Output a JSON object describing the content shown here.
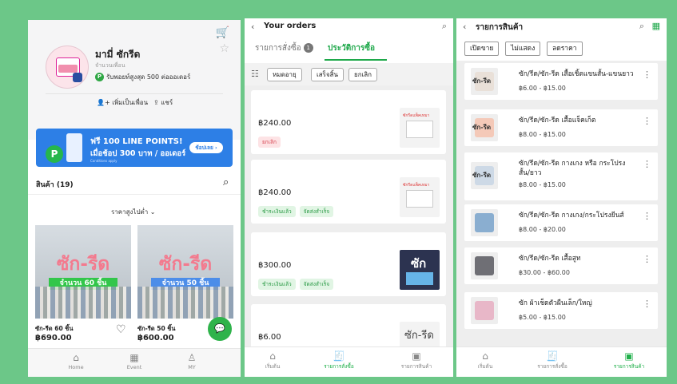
{
  "shop": {
    "name": "มามี่ ซักรีด",
    "subtitle": "จำนวนเพื่อน",
    "badge_letter": "P",
    "min_order": "รับพอยท์สูงสุด 500 ต่อออเดอร์",
    "add_friend": "เพิ่มเป็นเพื่อน",
    "share": "แชร์",
    "banner": {
      "line1": "ฟรี 100 LINE POINTS!",
      "line2": "เมื่อช้อป 300 บาท / ออเดอร์",
      "fine_print": "Conditions apply",
      "button": "ช้อปเลย ›"
    },
    "products_title": "สินค้า (19)",
    "sort_label": "ราคาสูงไปต่ำ ⌄",
    "products": [
      {
        "image_text": "ซัก-รีด",
        "label": "จำนวน 60 ชิ้น",
        "name": "ซัก-รีด 60 ชิ้น",
        "price": "฿690.00"
      },
      {
        "image_text": "ซัก-รีด",
        "label": "จำนวน 50 ชิ้น",
        "name": "ซัก-รีด 50 ชิ้น",
        "price": "฿600.00"
      }
    ],
    "nav": {
      "home": "Home",
      "event": "Event",
      "my": "MY"
    }
  },
  "orders": {
    "title": "Your orders",
    "tab_pending": "รายการสั่งซื้อ",
    "tab_pending_count": "1",
    "tab_history": "ประวัติการซื้อ",
    "chips": [
      "หมดอายุ",
      "เสร็จสิ้น",
      "ยกเลิก"
    ],
    "list": [
      {
        "price": "฿240.00",
        "statuses": [
          "ยกเลิก"
        ],
        "thumb_text": "ซักรีดแพ็คเหมา"
      },
      {
        "price": "฿240.00",
        "statuses": [
          "ชำระเงินแล้ว",
          "จัดส่งสำเร็จ"
        ],
        "thumb_text": "ซักรีดแพ็คเหมา"
      },
      {
        "price": "฿300.00",
        "statuses": [
          "ชำระเงินแล้ว",
          "จัดส่งสำเร็จ"
        ],
        "thumb_text": "ซัก"
      },
      {
        "price": "฿6.00",
        "statuses": [],
        "thumb_text": "ซัก-รีด"
      }
    ],
    "nav": {
      "home": "เริ่มต้น",
      "orders": "รายการสั่งซื้อ",
      "products": "รายการสินค้า"
    }
  },
  "products_list": {
    "title": "รายการสินค้า",
    "chips": [
      "เปิดขาย",
      "ไม่แสดง",
      "ลดราคา"
    ],
    "items": [
      {
        "thumb_text": "ซัก-รีด",
        "title": "ซัก/รีด/ซัก-รีด เสื้อเชิ้ตแขนสั้น-แขนยาว",
        "price": "฿6.00 - ฿15.00",
        "color": "#e9e0d8"
      },
      {
        "thumb_text": "ซัก-รีด",
        "title": "ซัก/รีด/ซัก-รีด เสื้อแจ็คเก็ต",
        "price": "฿8.00 - ฿15.00",
        "color": "#f4c9b8"
      },
      {
        "thumb_text": "ซัก-รีด",
        "title": "ซัก/รีด/ซัก-รีด กางเกง หรือ กระโปรง สั้น/ยาว",
        "price": "฿8.00 - ฿15.00",
        "color": "#cdd9e6"
      },
      {
        "thumb_text": "",
        "title": "ซัก/รีด/ซัก-รีด กางเกง/กระโปรงยีนส์",
        "price": "฿8.00 - ฿20.00",
        "color": "#8aaed0"
      },
      {
        "thumb_text": "",
        "title": "ซัก/รีด/ซัก-รีด เสื้อสูท",
        "price": "฿30.00 - ฿60.00",
        "color": "#6f6f75"
      },
      {
        "thumb_text": "",
        "title": "ซัก ผ้าเช็ดตัวผืนเล็ก/ใหญ่",
        "price": "฿5.00 - ฿15.00",
        "color": "#e8b7c8"
      }
    ],
    "nav": {
      "home": "เริ่มต้น",
      "orders": "รายการสั่งซื้อ",
      "products": "รายการสินค้า"
    }
  },
  "colors": {
    "line_green": "#1ea84a",
    "background_green": "#6cc788",
    "banner_blue": "#2d7fe6"
  }
}
